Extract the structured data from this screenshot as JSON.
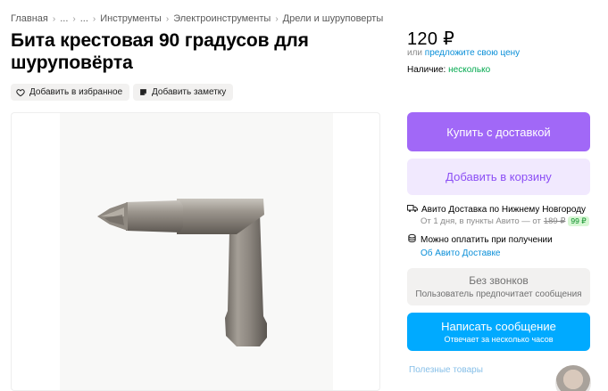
{
  "breadcrumb": [
    "Главная",
    "...",
    "...",
    "Инструменты",
    "Электроинструменты",
    "Дрели и шуруповерты"
  ],
  "title": "Бита крестовая 90 градусов для шуруповёрта",
  "actions": {
    "favorite": "Добавить в избранное",
    "note": "Добавить заметку"
  },
  "price": {
    "value": "120 ₽",
    "or": "или",
    "offer_link": "предложите свою цену"
  },
  "availability": {
    "label": "Наличие:",
    "value": "несколько"
  },
  "buttons": {
    "buy": "Купить с доставкой",
    "cart": "Добавить в корзину",
    "calls_title": "Без звонков",
    "calls_sub": "Пользователь предпочитает сообщения",
    "message_title": "Написать сообщение",
    "message_sub": "Отвечает за несколько часов"
  },
  "delivery": {
    "title": "Авито Доставка по Нижнему Новгороду",
    "sub_prefix": "От 1 дня, в пункты Авито — от",
    "old_price": "189 ₽",
    "new_price": "99 ₽",
    "pay_on_receipt": "Можно оплатить при получении",
    "about_link": "Об Авито Доставке"
  },
  "useful_goods": "Полезные товары",
  "colors": {
    "buy": "#a168f7",
    "cart_bg": "#f1e9fe",
    "message": "#00aaff",
    "link": "#0a8fd8",
    "available": "#03a94f"
  },
  "icons": [
    "heart-icon",
    "note-icon",
    "truck-icon",
    "coins-icon",
    "chevron-right-icon"
  ]
}
